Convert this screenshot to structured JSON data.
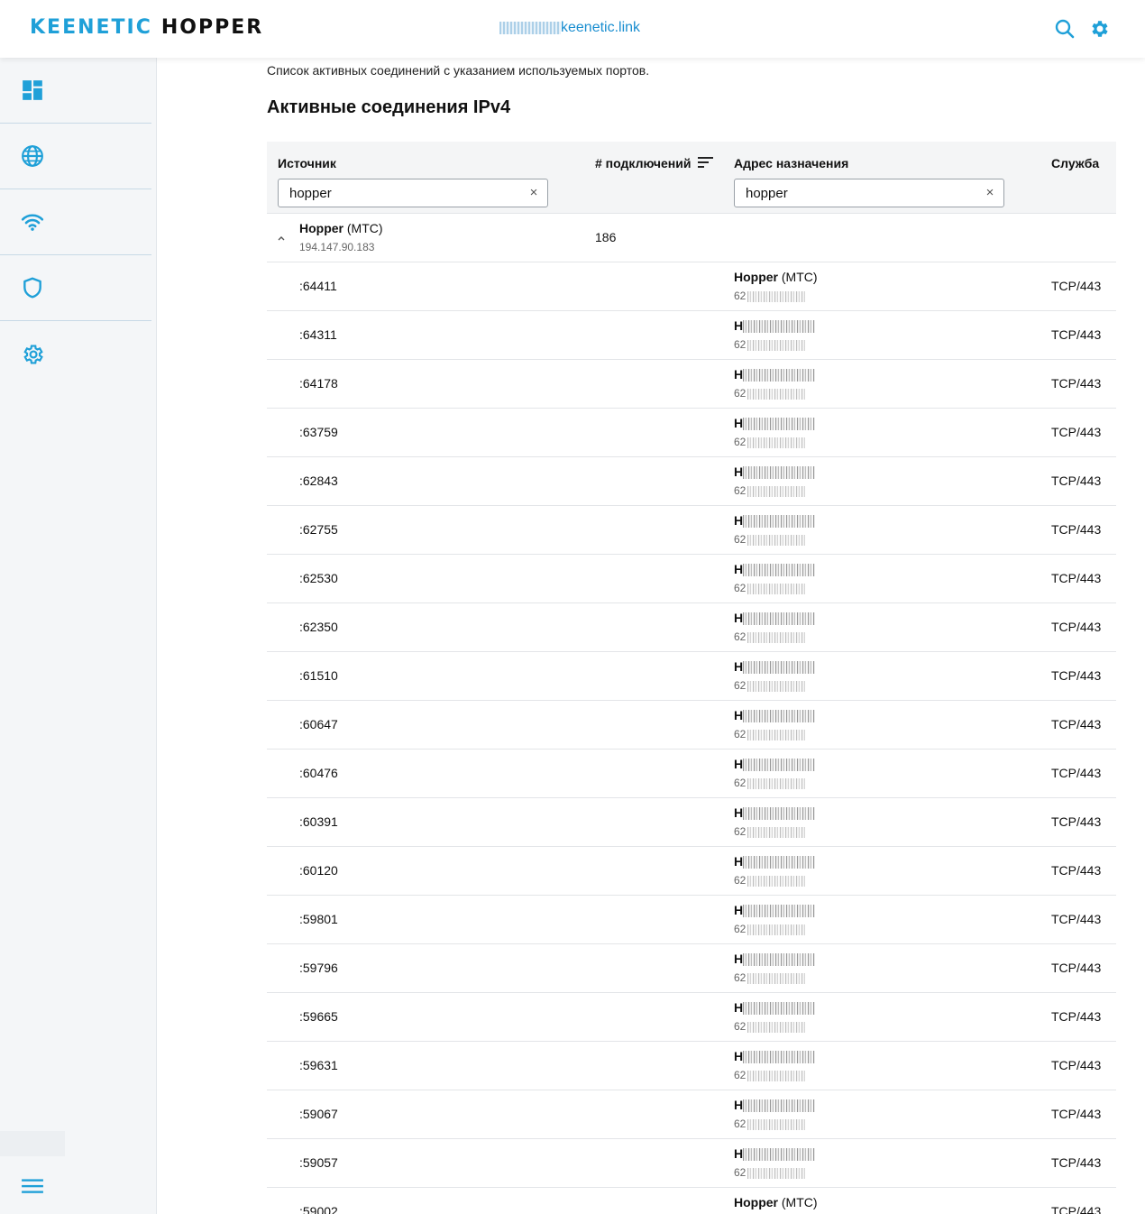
{
  "header": {
    "brand": "KEENETIC",
    "product": "HOPPER",
    "host_suffix": "keenetic.link"
  },
  "sidebar": {
    "items": [
      {
        "icon": "dashboard-icon"
      },
      {
        "icon": "globe-icon"
      },
      {
        "icon": "wifi-icon"
      },
      {
        "icon": "shield-icon"
      },
      {
        "icon": "gear-icon"
      }
    ],
    "toggle_icon": "menu-icon"
  },
  "colors": {
    "accent": "#1fa0d8",
    "text": "#111111",
    "muted": "#666666"
  },
  "main": {
    "intro": "Список активных соединений с указанием используемых портов.",
    "title": "Активные соединения IPv4",
    "columns": {
      "source": "Источник",
      "connections": "# подключений",
      "destination": "Адрес назначения",
      "service": "Служба"
    },
    "filters": {
      "source": "hopper",
      "destination": "hopper",
      "clear": "×"
    },
    "group": {
      "name": "Hopper",
      "isp": "(МТС)",
      "ip": "194.147.90.183",
      "connections": "186"
    },
    "dest_name": "Hopper",
    "dest_isp": "(МТС)",
    "dest_ip_prefix": "62",
    "rows": [
      {
        "port": ":64411",
        "service": "TCP/443",
        "dest_visible": true
      },
      {
        "port": ":64311",
        "service": "TCP/443",
        "dest_visible": false
      },
      {
        "port": ":64178",
        "service": "TCP/443",
        "dest_visible": false
      },
      {
        "port": ":63759",
        "service": "TCP/443",
        "dest_visible": false
      },
      {
        "port": ":62843",
        "service": "TCP/443",
        "dest_visible": false
      },
      {
        "port": ":62755",
        "service": "TCP/443",
        "dest_visible": false
      },
      {
        "port": ":62530",
        "service": "TCP/443",
        "dest_visible": false
      },
      {
        "port": ":62350",
        "service": "TCP/443",
        "dest_visible": false
      },
      {
        "port": ":61510",
        "service": "TCP/443",
        "dest_visible": false
      },
      {
        "port": ":60647",
        "service": "TCP/443",
        "dest_visible": false
      },
      {
        "port": ":60476",
        "service": "TCP/443",
        "dest_visible": false
      },
      {
        "port": ":60391",
        "service": "TCP/443",
        "dest_visible": false
      },
      {
        "port": ":60120",
        "service": "TCP/443",
        "dest_visible": false
      },
      {
        "port": ":59801",
        "service": "TCP/443",
        "dest_visible": false
      },
      {
        "port": ":59796",
        "service": "TCP/443",
        "dest_visible": false
      },
      {
        "port": ":59665",
        "service": "TCP/443",
        "dest_visible": false
      },
      {
        "port": ":59631",
        "service": "TCP/443",
        "dest_visible": false
      },
      {
        "port": ":59067",
        "service": "TCP/443",
        "dest_visible": false
      },
      {
        "port": ":59057",
        "service": "TCP/443",
        "dest_visible": false
      },
      {
        "port": ":59002",
        "service": "TCP/443",
        "dest_visible": true
      }
    ]
  }
}
